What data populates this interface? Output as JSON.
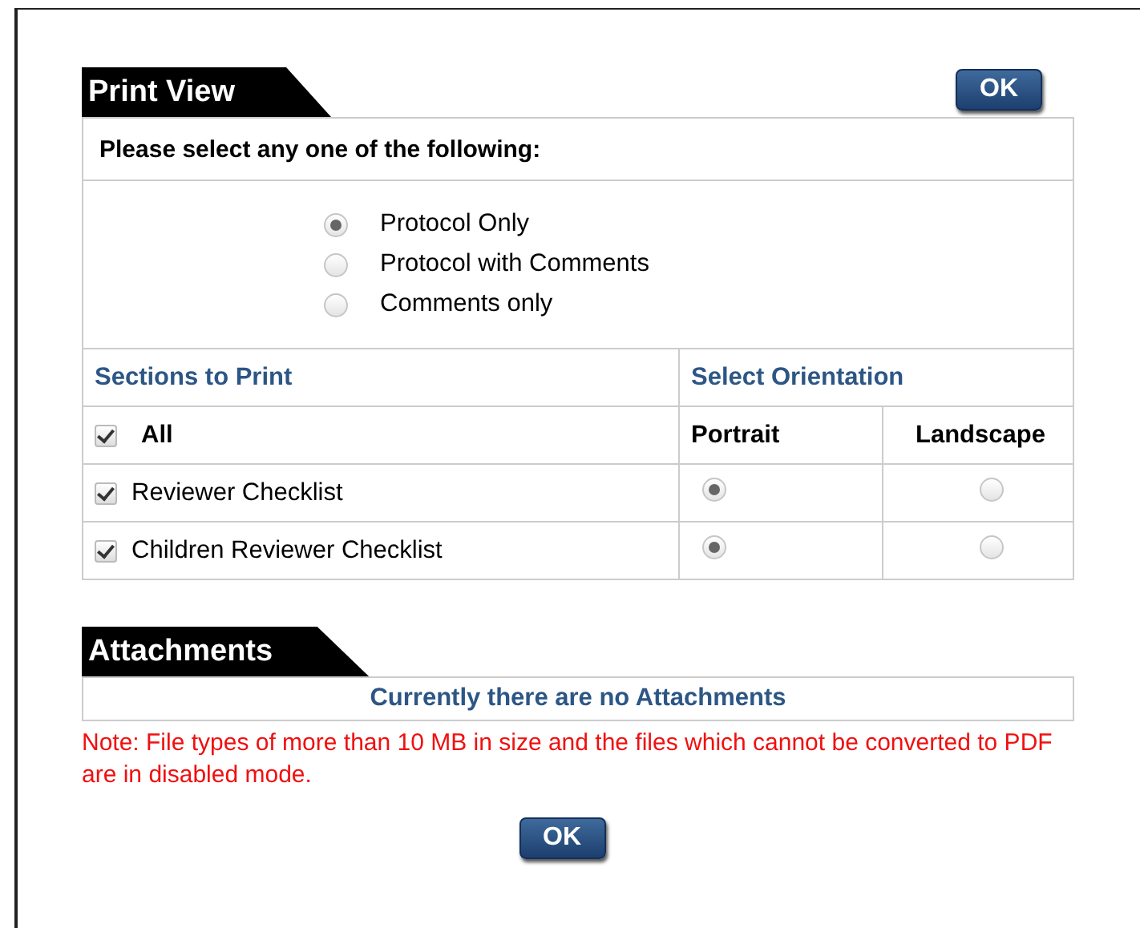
{
  "header": {
    "title": "Print View",
    "ok_button": "OK"
  },
  "prompt": "Please select any one of the following:",
  "print_options": [
    {
      "label": "Protocol Only",
      "selected": true
    },
    {
      "label": "Protocol with Comments",
      "selected": false
    },
    {
      "label": "Comments only",
      "selected": false
    }
  ],
  "sections": {
    "heading": "Sections to Print",
    "orientation_heading": "Select Orientation",
    "all": {
      "label": "All",
      "checked": true
    },
    "portrait_label": "Portrait",
    "landscape_label": "Landscape",
    "rows": [
      {
        "label": "Reviewer Checklist",
        "checked": true,
        "portrait": {
          "selected": true
        },
        "landscape": {
          "selected": false
        }
      },
      {
        "label": "Children Reviewer Checklist",
        "checked": true,
        "portrait": {
          "selected": true
        },
        "landscape": {
          "selected": false
        }
      }
    ]
  },
  "attachments": {
    "title": "Attachments",
    "message": "Currently there are no Attachments"
  },
  "note": "Note: File types of more than 10 MB in size and the files which cannot be converted to PDF are in disabled mode.",
  "footer_button": "OK"
}
